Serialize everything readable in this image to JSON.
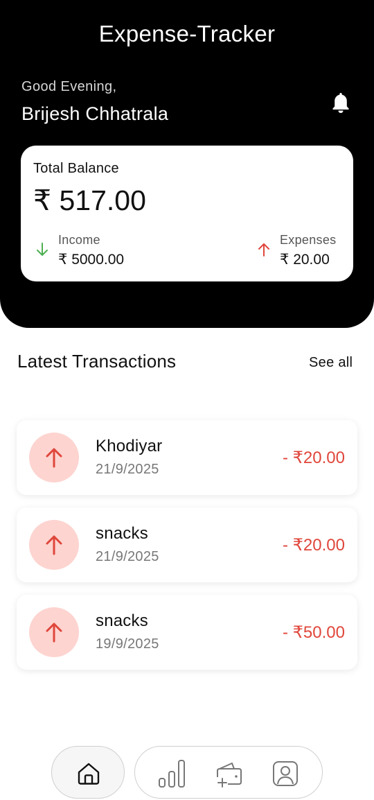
{
  "header": {
    "title": "Expense-Tracker",
    "greeting": "Good Evening,",
    "user_name": "Brijesh Chhatrala",
    "notification_icon": "bell-icon"
  },
  "balance": {
    "label": "Total Balance",
    "value": "₹ 517.00",
    "income": {
      "label": "Income",
      "value": "₹ 5000.00",
      "icon": "arrow-down-icon",
      "color": "#4caf50"
    },
    "expenses": {
      "label": "Expenses",
      "value": "₹ 20.00",
      "icon": "arrow-up-icon",
      "color": "#e0463b"
    }
  },
  "transactions": {
    "title": "Latest Transactions",
    "see_all": "See all",
    "items": [
      {
        "name": "Khodiyar",
        "date": "21/9/2025",
        "amount": "- ₹20.00"
      },
      {
        "name": "snacks",
        "date": "21/9/2025",
        "amount": "- ₹20.00"
      },
      {
        "name": "snacks",
        "date": "19/9/2025",
        "amount": "- ₹50.00"
      }
    ]
  },
  "nav": {
    "items": [
      "home-icon",
      "stats-icon",
      "add-wallet-icon",
      "profile-icon"
    ],
    "active": "home-icon"
  },
  "colors": {
    "header_bg": "#000000",
    "expense_red": "#e0463b",
    "expense_circle": "#fdd4d0",
    "income_green": "#4caf50"
  }
}
